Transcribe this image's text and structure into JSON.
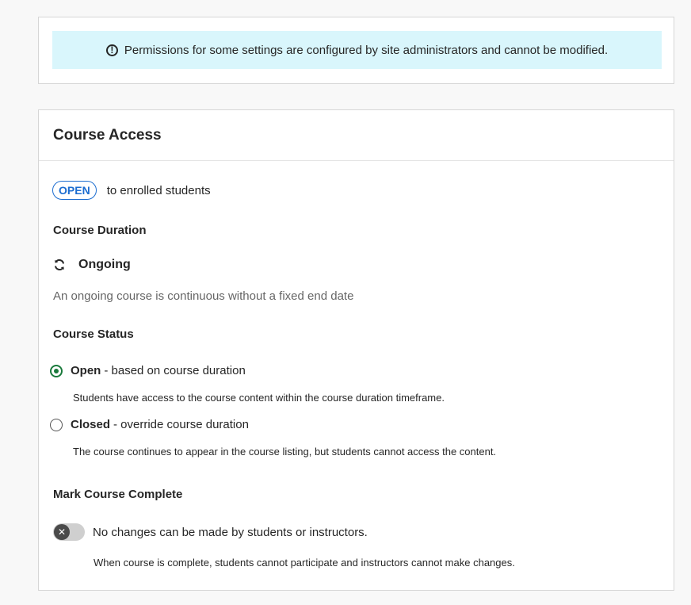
{
  "notice": {
    "icon": "info-icon",
    "text": "Permissions for some settings are configured by site administrators and cannot be modified."
  },
  "course_access": {
    "title": "Course Access",
    "status_badge": "OPEN",
    "status_suffix": "to enrolled students",
    "duration": {
      "heading": "Course Duration",
      "icon": "refresh-icon",
      "value": "Ongoing",
      "description": "An ongoing course is continuous without a fixed end date"
    },
    "status": {
      "heading": "Course Status",
      "options": [
        {
          "label": "Open",
          "suffix": "- based on course duration",
          "help": "Students have access to the course content within the course duration timeframe.",
          "checked": true
        },
        {
          "label": "Closed",
          "suffix": "- override course duration",
          "help": "The course continues to appear in the course listing, but students cannot access the content.",
          "checked": false
        }
      ]
    },
    "complete": {
      "heading": "Mark Course Complete",
      "toggle_on": false,
      "toggle_text": "No changes can be made by students or instructors.",
      "help": "When course is complete, students cannot participate and instructors cannot make changes."
    }
  },
  "colors": {
    "notice_bg": "#d9f6fc",
    "badge": "#1c6dd0",
    "radio_checked": "#1a7a3c",
    "page_bg": "#f8f8f8"
  }
}
